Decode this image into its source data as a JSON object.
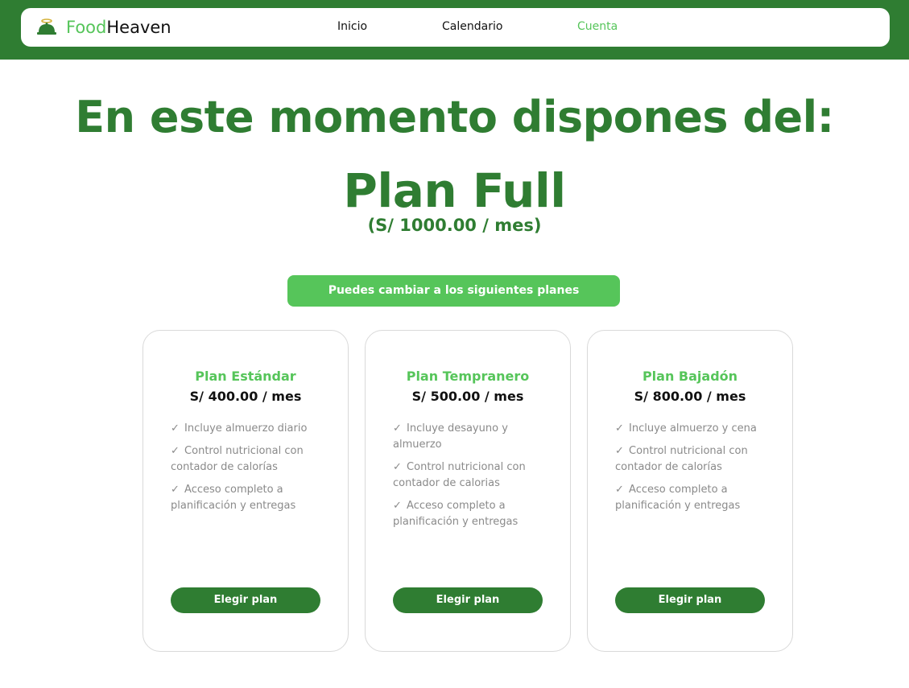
{
  "nav": {
    "brand_part1": "Food",
    "brand_part2": "Heaven",
    "brand_icon": "cloche-icon",
    "links": [
      {
        "label": "Inicio",
        "active": false
      },
      {
        "label": "Calendario",
        "active": false
      },
      {
        "label": "Cuenta",
        "active": true
      }
    ]
  },
  "current_plan": {
    "headline": "En este momento dispones del:",
    "name": "Plan Full",
    "price": "(S/ 1000.00 / mes)"
  },
  "change_banner": "Puedes cambiar a los siguientes planes",
  "plans": [
    {
      "title": "Plan Estándar",
      "price": "S/ 400.00 / mes",
      "features": [
        "Incluye almuerzo diario",
        "Control nutricional con contador de calorías",
        "Acceso completo a planificación y entregas"
      ],
      "button": "Elegir plan"
    },
    {
      "title": "Plan Tempranero",
      "price": "S/ 500.00 / mes",
      "features": [
        "Incluye desayuno y almuerzo",
        "Control nutricional con contador de calorias",
        "Acceso completo a planificación y entregas"
      ],
      "button": "Elegir plan"
    },
    {
      "title": "Plan Bajadón",
      "price": "S/ 800.00 / mes",
      "features": [
        "Incluye almuerzo y cena",
        "Control nutricional con contador de calorías",
        "Acceso completo a planificación y entregas"
      ],
      "button": "Elegir plan"
    }
  ],
  "check_mark": "✓",
  "colors": {
    "primary_dark": "#2f7d32",
    "primary_light": "#56c55a",
    "muted_text": "#8a8a8a"
  }
}
